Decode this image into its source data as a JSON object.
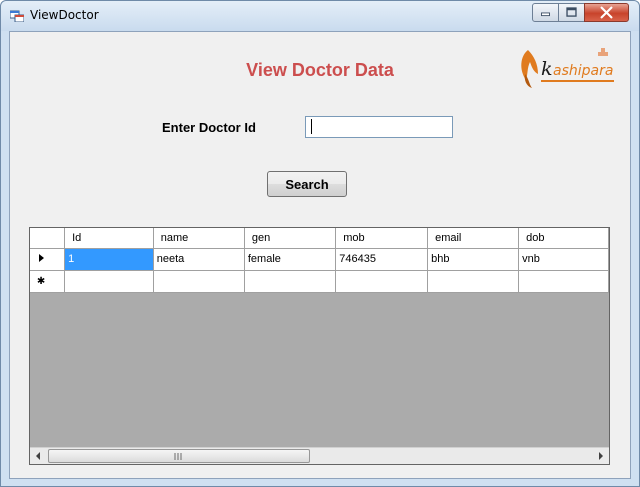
{
  "window": {
    "title": "ViewDoctor",
    "controls": {
      "minimize": "minimize-icon",
      "maximize": "maximize-icon",
      "close": "close-icon"
    },
    "accent": "#c8432b"
  },
  "form": {
    "heading": "View Doctor Data",
    "heading_color": "#cc4e4e",
    "logo_text": "kashipara",
    "logo_color": "#e07b1f",
    "id_label": "Enter Doctor Id",
    "id_value": "",
    "id_placeholder": "",
    "search_label": "Search"
  },
  "grid": {
    "columns": [
      "Id",
      "name",
      "gen",
      "mob",
      "email",
      "dob"
    ],
    "rows": [
      {
        "id": "1",
        "name": "neeta",
        "gen": "female",
        "mob": "746435",
        "email": "bhb",
        "dob": "vnb"
      }
    ],
    "selection_color": "#3399ff",
    "scroll_grip": "|||"
  }
}
